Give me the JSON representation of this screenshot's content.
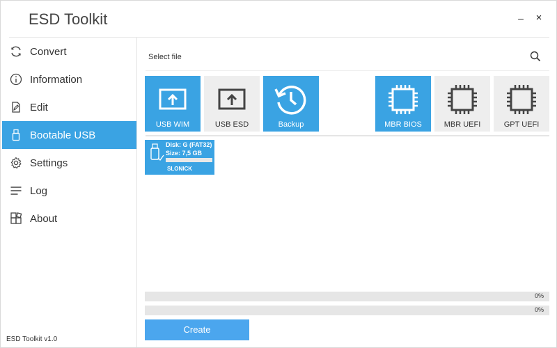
{
  "app": {
    "title": "ESD Toolkit",
    "version": "ESD Toolkit v1.0"
  },
  "window": {
    "minimize_label": "–",
    "close_label": "×"
  },
  "sidebar": {
    "items": [
      {
        "label": "Convert",
        "icon": "refresh-icon",
        "active": false
      },
      {
        "label": "Information",
        "icon": "info-icon",
        "active": false
      },
      {
        "label": "Edit",
        "icon": "edit-icon",
        "active": false
      },
      {
        "label": "Bootable USB",
        "icon": "usb-icon",
        "active": true
      },
      {
        "label": "Settings",
        "icon": "gear-icon",
        "active": false
      },
      {
        "label": "Log",
        "icon": "list-icon",
        "active": false
      },
      {
        "label": "About",
        "icon": "about-icon",
        "active": false
      }
    ]
  },
  "file": {
    "placeholder": "Select file",
    "value": ""
  },
  "tiles": [
    {
      "label": "USB WIM",
      "icon": "upload-screen-icon",
      "selected": true
    },
    {
      "label": "USB ESD",
      "icon": "upload-screen-icon",
      "selected": false
    },
    {
      "label": "Backup",
      "icon": "history-icon",
      "selected": true
    },
    {
      "label": "MBR BIOS",
      "icon": "chip-icon",
      "selected": true
    },
    {
      "label": "MBR UEFI",
      "icon": "chip-icon",
      "selected": false
    },
    {
      "label": "GPT UEFI",
      "icon": "chip-icon",
      "selected": false
    }
  ],
  "usb_device": {
    "disk": "Disk: G (FAT32)",
    "size": "Size: 7,5 GB",
    "name": "SLONICK",
    "used_fraction": 0
  },
  "progress": [
    {
      "value": 0,
      "text": "0%"
    },
    {
      "value": 0,
      "text": "0%"
    }
  ],
  "actions": {
    "create_label": "Create"
  },
  "colors": {
    "accent": "#3aa3e3",
    "button": "#4ba6ee",
    "tile_inactive": "#eeeeee"
  }
}
